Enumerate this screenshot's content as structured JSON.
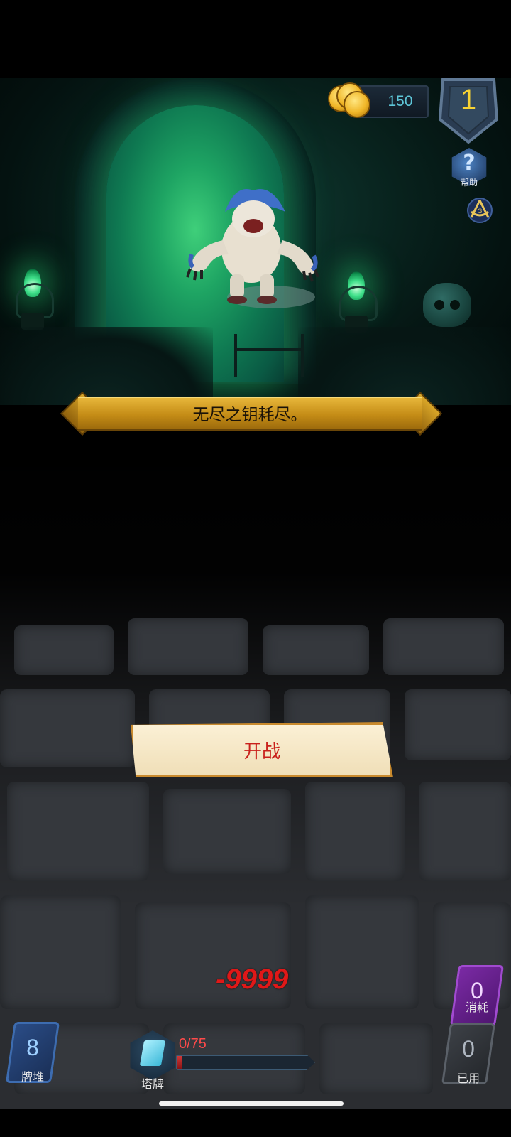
{
  "hud": {
    "coins": "150",
    "level": "1",
    "help_label": "帮助"
  },
  "banner": {
    "message": "无尽之钥耗尽。"
  },
  "fight_button": {
    "label": "开战"
  },
  "damage_popup": "-9999",
  "bottom": {
    "deck": {
      "count": "8",
      "label": "牌堆"
    },
    "tower": {
      "label": "塔牌",
      "progress_text": "0/75",
      "progress_fraction": 0.03
    },
    "consume": {
      "count": "0",
      "label": "消耗"
    },
    "used": {
      "count": "0",
      "label": "已用"
    }
  },
  "colors": {
    "coin_text": "#5ec6d8",
    "level_text": "#f7d233",
    "banner_gold": "#c48c16",
    "fight_text": "#c9201b",
    "damage_text": "#e01818"
  },
  "icons": [
    "coin-stack-icon",
    "level-shield-icon",
    "help-icon",
    "masonic-emblem-icon",
    "monster-yeti",
    "tower-crystal-icon"
  ]
}
